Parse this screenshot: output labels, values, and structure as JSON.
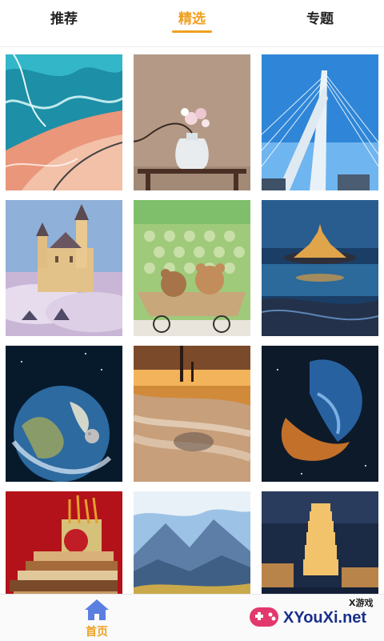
{
  "tabs": [
    {
      "label": "推荐",
      "active": false
    },
    {
      "label": "精选",
      "active": true
    },
    {
      "label": "专题",
      "active": false
    }
  ],
  "accent_color": "#f0a020",
  "gallery": [
    {
      "subject": "aerial teal river and coral land"
    },
    {
      "subject": "white vase with flowers on table"
    },
    {
      "subject": "cable-stayed bridge under blue sky"
    },
    {
      "subject": "fairytale castle above clouds"
    },
    {
      "subject": "teddy bears in wicker cart"
    },
    {
      "subject": "island abbey at dusk with reflection"
    },
    {
      "subject": "planet earth and moon in space"
    },
    {
      "subject": "sunset seascape with long exposure waves"
    },
    {
      "subject": "blue and orange nebula"
    },
    {
      "subject": "stack of books with red apple"
    },
    {
      "subject": "mountain valley with autumn trees"
    },
    {
      "subject": "illuminated pagoda city at night"
    }
  ],
  "bottom_nav": {
    "home_label": "首页",
    "home_icon": "home-icon"
  },
  "watermark": {
    "small_text": "X游戏",
    "main_text": "XYouXi.net"
  }
}
